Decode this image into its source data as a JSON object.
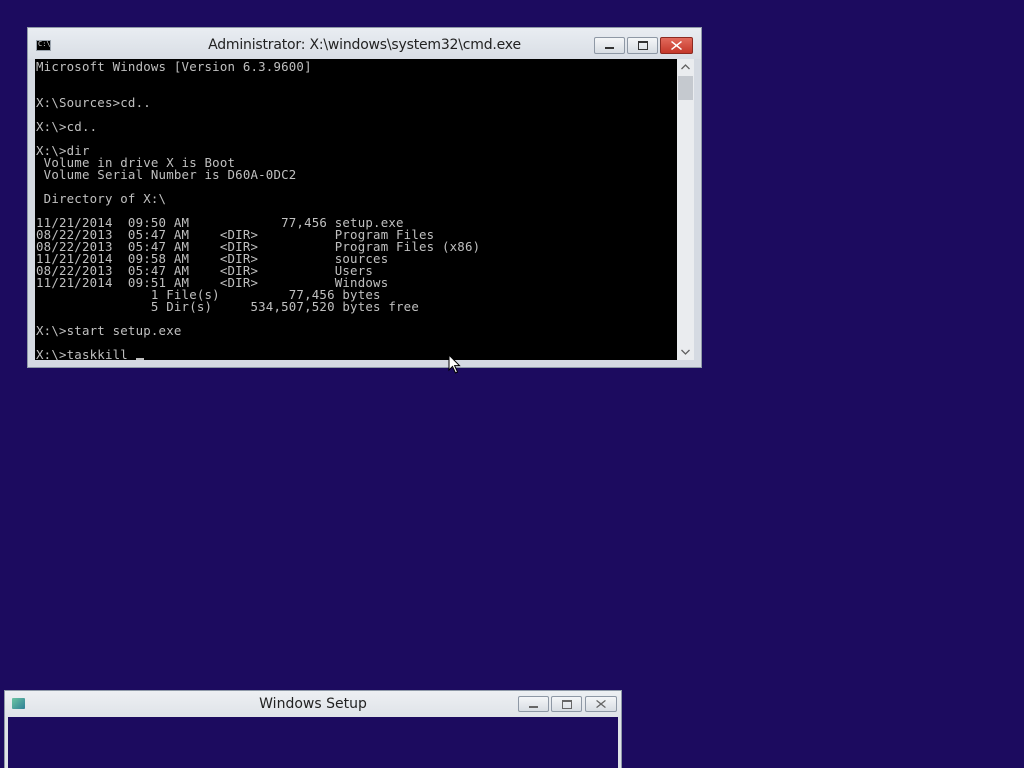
{
  "cmd_window": {
    "title": "Administrator: X:\\windows\\system32\\cmd.exe",
    "icon": "cmd-icon",
    "buttons": {
      "minimize": "minimize-icon",
      "maximize": "maximize-icon",
      "close": "close-icon"
    },
    "console": {
      "lines": [
        "Microsoft Windows [Version 6.3.9600]",
        "",
        "",
        "X:\\Sources>cd..",
        "",
        "X:\\>cd..",
        "",
        "X:\\>dir",
        " Volume in drive X is Boot",
        " Volume Serial Number is D60A-0DC2",
        "",
        " Directory of X:\\",
        "",
        "11/21/2014  09:50 AM            77,456 setup.exe",
        "08/22/2013  05:47 AM    <DIR>          Program Files",
        "08/22/2013  05:47 AM    <DIR>          Program Files (x86)",
        "11/21/2014  09:58 AM    <DIR>          sources",
        "08/22/2013  05:47 AM    <DIR>          Users",
        "11/21/2014  09:51 AM    <DIR>          Windows",
        "               1 File(s)         77,456 bytes",
        "               5 Dir(s)     534,507,520 bytes free",
        "",
        "X:\\>start setup.exe",
        ""
      ],
      "current_input": "X:\\>taskkill"
    }
  },
  "setup_window": {
    "title": "Windows Setup",
    "icon": "setup-icon"
  },
  "colors": {
    "desktop": "#1c0b5f",
    "console_bg": "#000000",
    "console_text": "#c0c0c0",
    "close_button": "#c4382a"
  }
}
